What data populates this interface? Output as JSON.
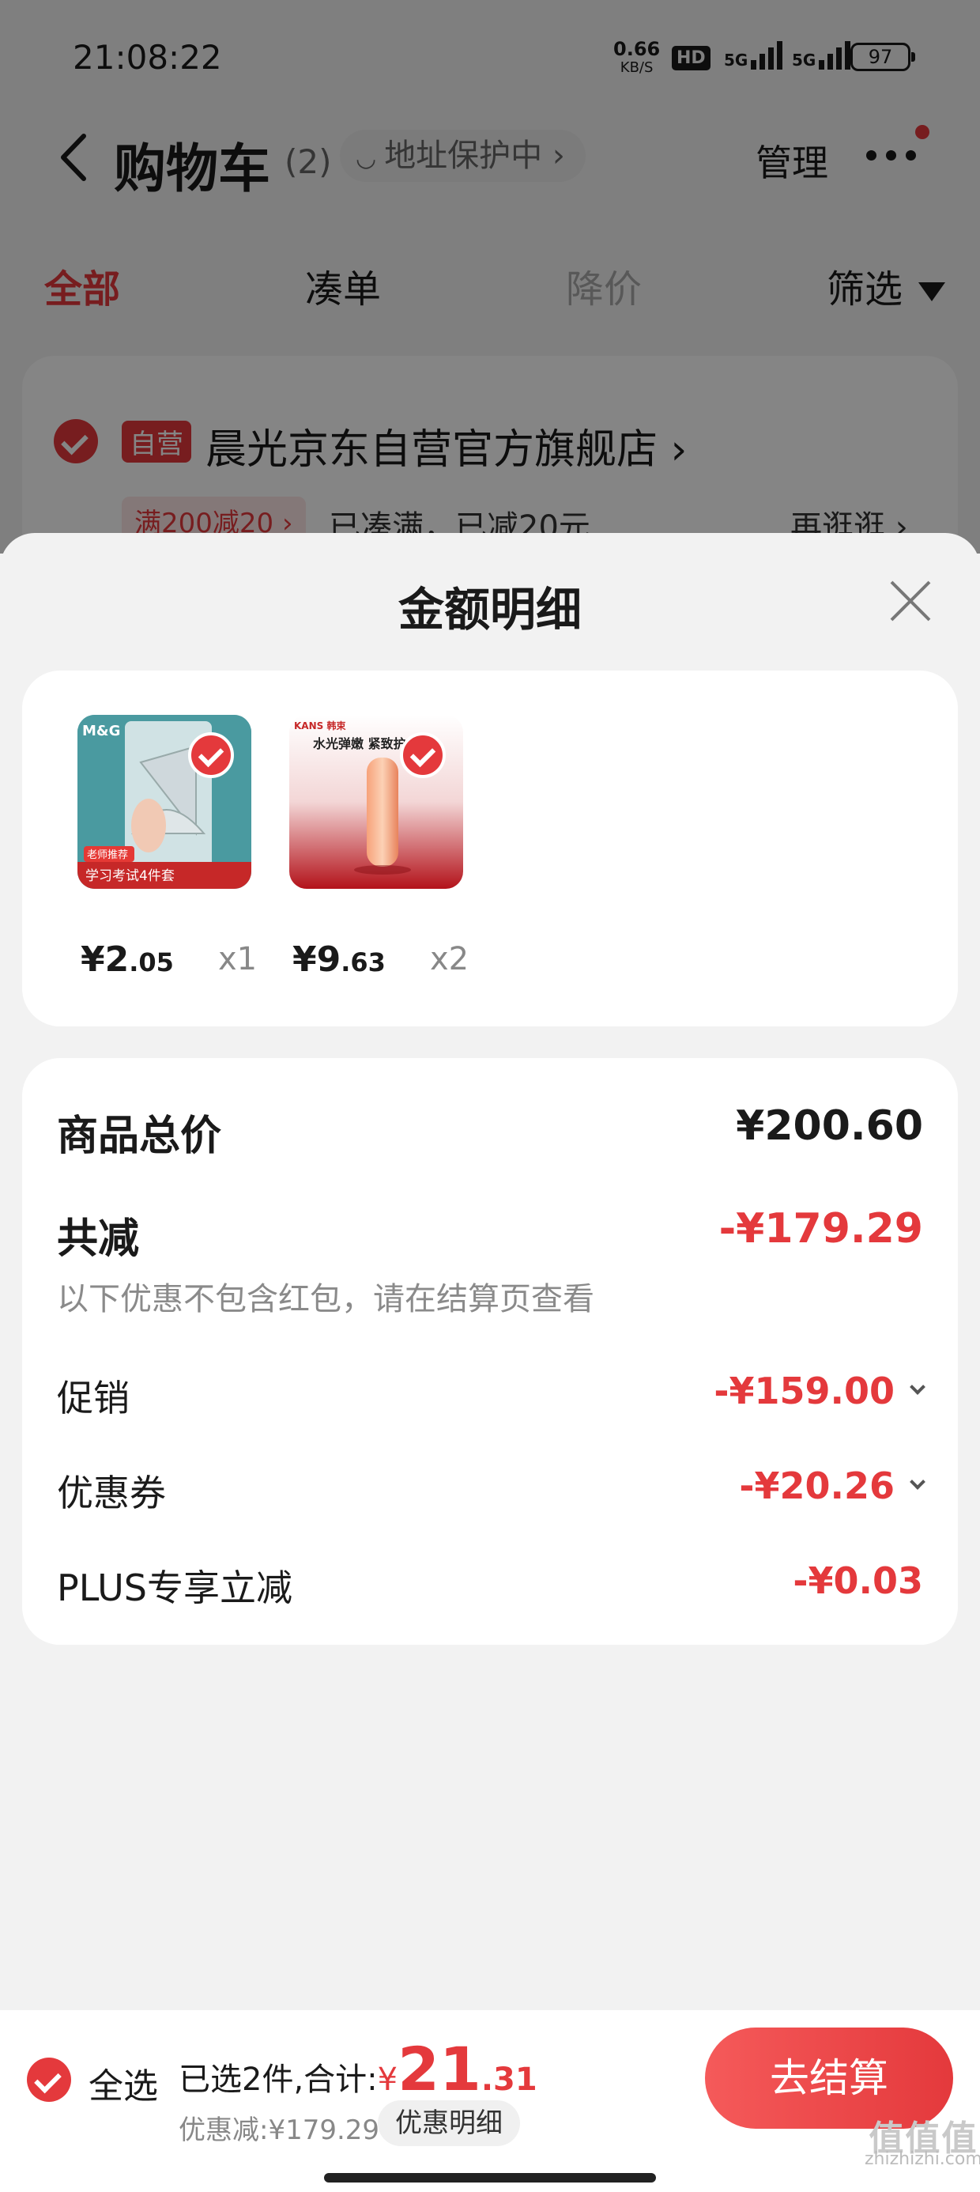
{
  "status_bar": {
    "time": "21:08:22",
    "net_speed": "0.66",
    "net_unit": "KB/S",
    "hd": "HD",
    "sig1": "5G",
    "sig2": "5G",
    "battery": "97"
  },
  "nav": {
    "title": "购物车",
    "count": "(2)",
    "address_protect": "地址保护中",
    "manage": "管理"
  },
  "tabs": [
    {
      "label": "全部"
    },
    {
      "label": "凑单"
    },
    {
      "label": "降价"
    },
    {
      "label": "筛选"
    }
  ],
  "shop": {
    "badge": "自营",
    "name": "晨光京东自营官方旗舰店",
    "promo_tag": "满200减20",
    "promo_text": "已凑满，已减20元",
    "more": "再逛逛"
  },
  "sheet": {
    "title": "金额明细",
    "items": [
      {
        "price_int": "¥2",
        "price_dec": ".05",
        "qty": "x1",
        "thumb_caption": "学习考试4件套",
        "thumb_tag": "老师推荐",
        "thumb_brand": "M&G"
      },
      {
        "price_int": "¥9",
        "price_dec": ".63",
        "qty": "x2",
        "thumb_caption": "水光弹嫩 紧致护",
        "thumb_brand": "KANS 韩束"
      }
    ],
    "total_label": "商品总价",
    "total_value": "¥200.60",
    "reduce_label": "共减",
    "reduce_value": "-¥179.29",
    "reduce_note": "以下优惠不包含红包，请在结算页查看",
    "rows": [
      {
        "label": "促销",
        "value": "-¥159.00"
      },
      {
        "label": "优惠券",
        "value": "-¥20.26"
      },
      {
        "label": "PLUS专享立减",
        "value": "-¥0.03"
      }
    ]
  },
  "bottom": {
    "select_all": "全选",
    "summary_prefix": "已选2件,合计:",
    "currency": "¥",
    "total_int": "21",
    "total_dec": ".31",
    "discount": "优惠减:¥179.29",
    "detail_btn": "优惠明细",
    "checkout": "去结算"
  },
  "watermark": {
    "mark": "值值值",
    "site": "zhizhizhi.com"
  },
  "colors": {
    "accent": "#e4393c",
    "muted_text": "#8a8a8a",
    "sheet_bg": "#f2f2f2"
  }
}
